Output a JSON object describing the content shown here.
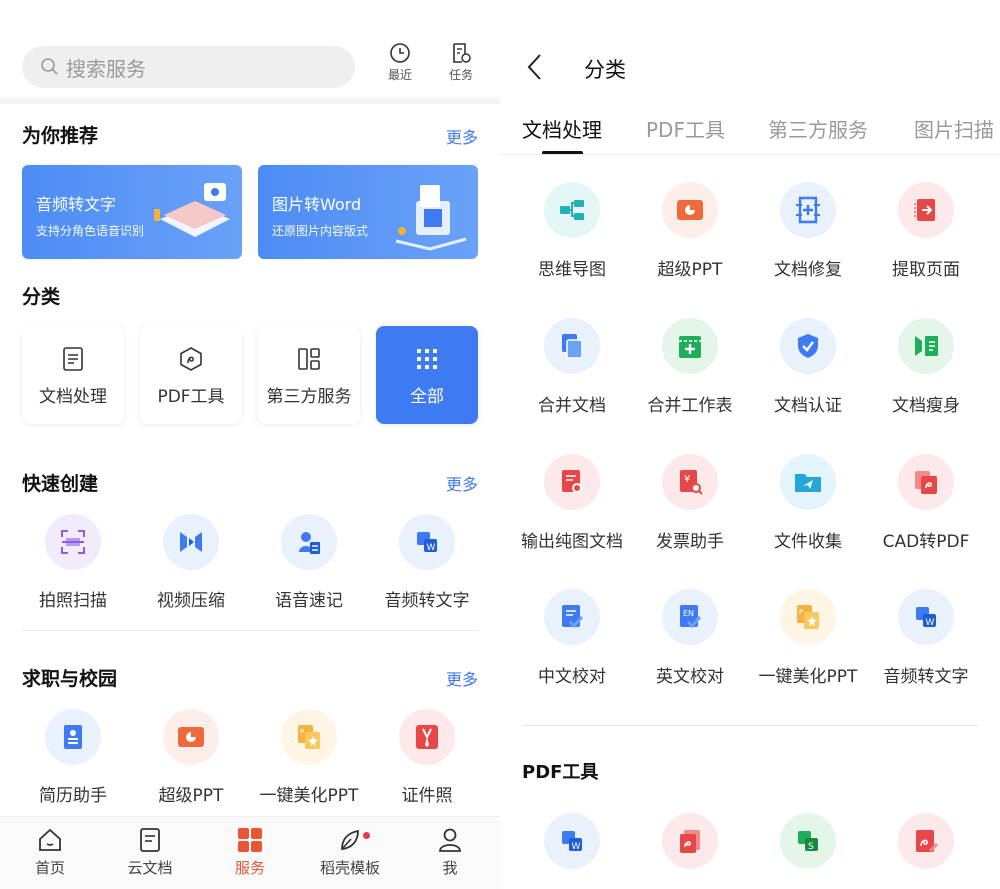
{
  "left": {
    "search": {
      "placeholder": "搜索服务"
    },
    "toolbar": {
      "recent_label": "最近",
      "tasks_label": "任务"
    },
    "recommend": {
      "title": "为你推荐",
      "more": "更多",
      "banners": [
        {
          "title": "音频转文字",
          "subtitle": "支持分角色语音识别"
        },
        {
          "title": "图片转Word",
          "subtitle": "还原图片内容版式"
        }
      ]
    },
    "category": {
      "title": "分类",
      "items": [
        {
          "label": "文档处理",
          "icon": "document-icon"
        },
        {
          "label": "PDF工具",
          "icon": "pdf-icon"
        },
        {
          "label": "第三方服务",
          "icon": "apps-grid-icon"
        },
        {
          "label": "全部",
          "icon": "dots-grid-icon"
        }
      ]
    },
    "quick": {
      "title": "快速创建",
      "more": "更多",
      "items": [
        {
          "label": "拍照扫描",
          "icon": "scan-icon"
        },
        {
          "label": "视频压缩",
          "icon": "video-compress-icon"
        },
        {
          "label": "语音速记",
          "icon": "voice-note-icon"
        },
        {
          "label": "音频转文字",
          "icon": "audio-to-text-icon"
        }
      ]
    },
    "campus": {
      "title": "求职与校园",
      "more": "更多",
      "items": [
        {
          "label": "简历助手",
          "icon": "resume-icon"
        },
        {
          "label": "超级PPT",
          "icon": "ppt-icon"
        },
        {
          "label": "一键美化PPT",
          "icon": "beautify-ppt-icon"
        },
        {
          "label": "证件照",
          "icon": "id-photo-icon"
        }
      ]
    },
    "nav": [
      {
        "label": "首页",
        "icon": "home-icon"
      },
      {
        "label": "云文档",
        "icon": "cloud-doc-icon"
      },
      {
        "label": "服务",
        "icon": "service-icon"
      },
      {
        "label": "稻壳模板",
        "icon": "template-icon"
      },
      {
        "label": "我",
        "icon": "profile-icon"
      }
    ],
    "colors": {
      "accent": "#3e7bf3",
      "nav_active": "#e85634"
    }
  },
  "right": {
    "title": "分类",
    "tabs": [
      "文档处理",
      "PDF工具",
      "第三方服务",
      "图片扫描"
    ],
    "grid": [
      {
        "label": "思维导图",
        "icon": "mindmap-icon"
      },
      {
        "label": "超级PPT",
        "icon": "ppt-icon"
      },
      {
        "label": "文档修复",
        "icon": "doc-repair-icon"
      },
      {
        "label": "提取页面",
        "icon": "extract-page-icon"
      },
      {
        "label": "合并文档",
        "icon": "merge-doc-icon"
      },
      {
        "label": "合并工作表",
        "icon": "merge-sheet-icon"
      },
      {
        "label": "文档认证",
        "icon": "doc-cert-icon"
      },
      {
        "label": "文档瘦身",
        "icon": "doc-slim-icon"
      },
      {
        "label": "输出纯图文档",
        "icon": "export-image-doc-icon"
      },
      {
        "label": "发票助手",
        "icon": "invoice-icon"
      },
      {
        "label": "文件收集",
        "icon": "file-collect-icon"
      },
      {
        "label": "CAD转PDF",
        "icon": "cad-to-pdf-icon"
      },
      {
        "label": "中文校对",
        "icon": "cn-proofread-icon"
      },
      {
        "label": "英文校对",
        "icon": "en-proofread-icon"
      },
      {
        "label": "一键美化PPT",
        "icon": "beautify-ppt-icon"
      },
      {
        "label": "音频转文字",
        "icon": "audio-to-text-icon"
      }
    ],
    "pdf_section": {
      "title": "PDF工具"
    }
  }
}
